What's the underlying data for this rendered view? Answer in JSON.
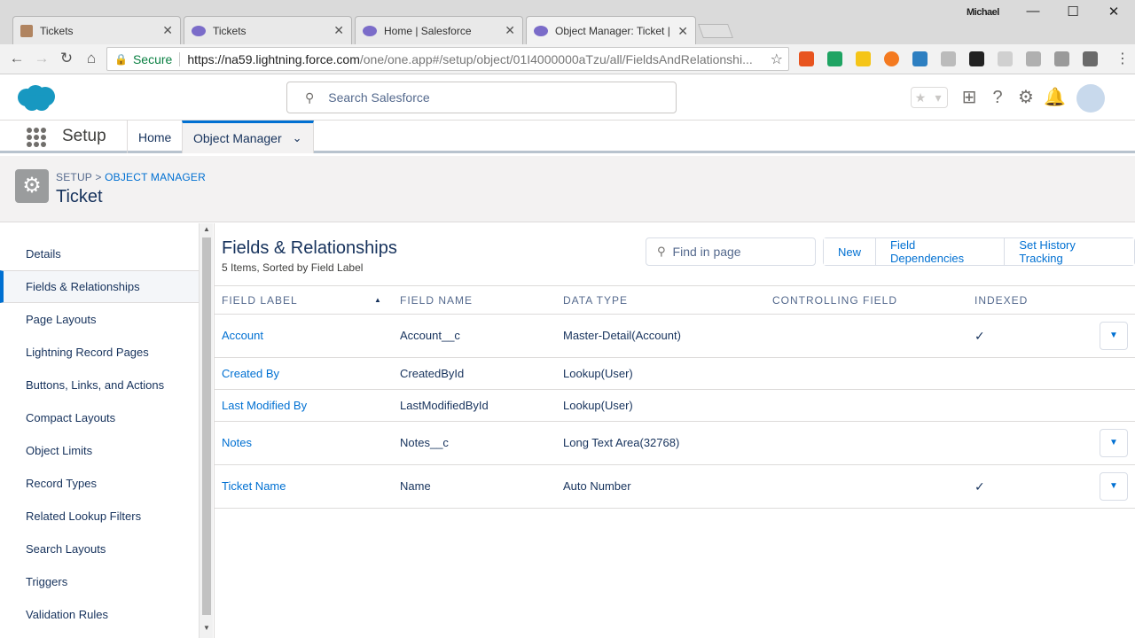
{
  "browser": {
    "tabs": [
      {
        "title": "Tickets",
        "icon": "ticket-favicon"
      },
      {
        "title": "Tickets",
        "icon": "salesforce-cloud-favicon"
      },
      {
        "title": "Home | Salesforce",
        "icon": "salesforce-cloud-favicon"
      },
      {
        "title": "Object Manager: Ticket |",
        "icon": "salesforce-cloud-favicon"
      }
    ],
    "close_glyph": "✕",
    "user": "Michael",
    "secure_label": "Secure",
    "url_host": "https://na59.lightning.force.com",
    "url_path": "/one/one.app#/setup/object/01I4000000aTzu/all/FieldsAndRelationshi..."
  },
  "sf_header": {
    "search_placeholder": "Search Salesforce"
  },
  "app_nav": {
    "app_name": "Setup",
    "items": [
      "Home",
      "Object Manager"
    ]
  },
  "page_header": {
    "crumb_setup": "SETUP",
    "crumb_sep": " > ",
    "crumb_object_manager": "OBJECT MANAGER",
    "title": "Ticket"
  },
  "sidebar": {
    "items": [
      "Details",
      "Fields & Relationships",
      "Page Layouts",
      "Lightning Record Pages",
      "Buttons, Links, and Actions",
      "Compact Layouts",
      "Object Limits",
      "Record Types",
      "Related Lookup Filters",
      "Search Layouts",
      "Triggers",
      "Validation Rules"
    ],
    "active": "Fields & Relationships"
  },
  "main": {
    "title": "Fields & Relationships",
    "subtitle": "5 Items, Sorted by Field Label",
    "find_placeholder": "Find in page",
    "buttons": [
      "New",
      "Field Dependencies",
      "Set History Tracking"
    ],
    "columns": [
      "FIELD LABEL",
      "FIELD NAME",
      "DATA TYPE",
      "CONTROLLING FIELD",
      "INDEXED"
    ],
    "rows": [
      {
        "label": "Account",
        "name": "Account__c",
        "type": "Master-Detail(Account)",
        "controlling": "",
        "indexed": true,
        "menu": true
      },
      {
        "label": "Created By",
        "name": "CreatedById",
        "type": "Lookup(User)",
        "controlling": "",
        "indexed": false,
        "menu": false
      },
      {
        "label": "Last Modified By",
        "name": "LastModifiedById",
        "type": "Lookup(User)",
        "controlling": "",
        "indexed": false,
        "menu": false
      },
      {
        "label": "Notes",
        "name": "Notes__c",
        "type": "Long Text Area(32768)",
        "controlling": "",
        "indexed": false,
        "menu": true
      },
      {
        "label": "Ticket Name",
        "name": "Name",
        "type": "Auto Number",
        "controlling": "",
        "indexed": true,
        "menu": true
      }
    ]
  },
  "colors": {
    "brand": "#0070d2",
    "salesforce_cloud": "#1798c1",
    "text": "#16325c"
  }
}
